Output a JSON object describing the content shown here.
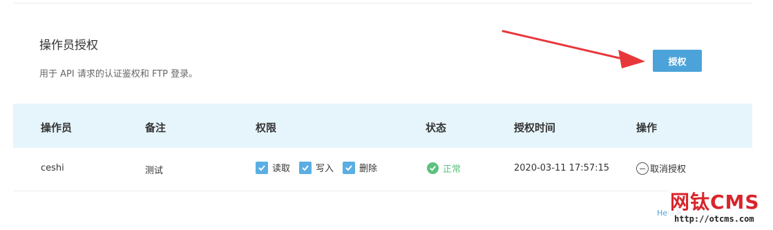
{
  "section": {
    "title": "操作员授权",
    "description": "用于 API 请求的认证鉴权和 FTP 登录。",
    "authorize_button": "授权"
  },
  "table": {
    "headers": [
      "操作员",
      "备注",
      "权限",
      "状态",
      "授权时间",
      "操作"
    ],
    "rows": [
      {
        "operator": "ceshi",
        "note": "测试",
        "permissions": [
          {
            "label": "读取",
            "checked": true
          },
          {
            "label": "写入",
            "checked": true
          },
          {
            "label": "删除",
            "checked": true
          }
        ],
        "status": "正常",
        "time": "2020-03-11 17:57:15",
        "action": "取消授权"
      }
    ]
  },
  "help": {
    "label": "Help",
    "icon": "caret-right-icon"
  },
  "watermark": {
    "logo": "网钛CMS",
    "url": "http://otcms.com"
  },
  "colors": {
    "accent": "#4ba3d9",
    "header_bg": "#e6f5fc",
    "status_ok": "#5cc27e",
    "arrow": "#e8373b",
    "checkbox": "#5aaee3"
  }
}
